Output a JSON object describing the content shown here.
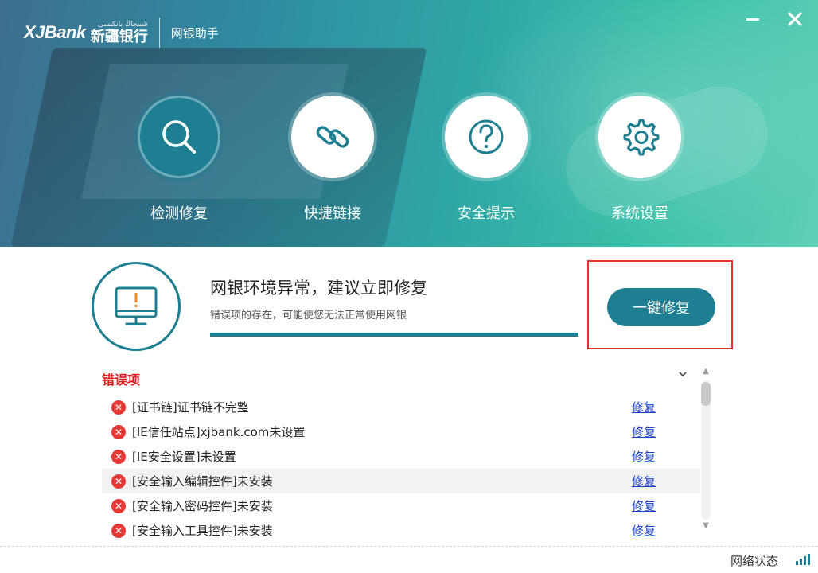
{
  "header": {
    "brand": "XJBank",
    "brand_cn": "新疆银行",
    "brand_ug": "شىنجاڭ بانكىسى",
    "app_title": "网银助手",
    "minimize_label": "—",
    "close_label": "✕"
  },
  "nav": [
    {
      "label": "检测修复",
      "icon": "search-icon",
      "active": true
    },
    {
      "label": "快捷链接",
      "icon": "link-icon",
      "active": false
    },
    {
      "label": "安全提示",
      "icon": "help-icon",
      "active": false
    },
    {
      "label": "系统设置",
      "icon": "gear-icon",
      "active": false
    }
  ],
  "status": {
    "icon": "monitor-warning-icon",
    "title": "网银环境异常，建议立即修复",
    "subtitle": "错误项的存在，可能使您无法正常使用网银",
    "progress": 1.0,
    "fix_button": "一键修复"
  },
  "errors": {
    "header": "错误项",
    "collapse": "⌄",
    "items": [
      {
        "text": "[证书链]证书链不完整",
        "action": "修复"
      },
      {
        "text": "[IE信任站点]xjbank.com未设置",
        "action": "修复"
      },
      {
        "text": "[IE安全设置]未设置",
        "action": "修复"
      },
      {
        "text": "[安全输入编辑控件]未安装",
        "action": "修复"
      },
      {
        "text": "[安全输入密码控件]未安装",
        "action": "修复"
      },
      {
        "text": "[安全输入工具控件]未安装",
        "action": "修复"
      }
    ]
  },
  "footer": {
    "network_label": "网络状态",
    "signal_icon": "signal-icon"
  },
  "colors": {
    "accent": "#1f7f92",
    "error": "#e53935",
    "highlight_border": "#e5322d",
    "link": "#1a40c8"
  }
}
